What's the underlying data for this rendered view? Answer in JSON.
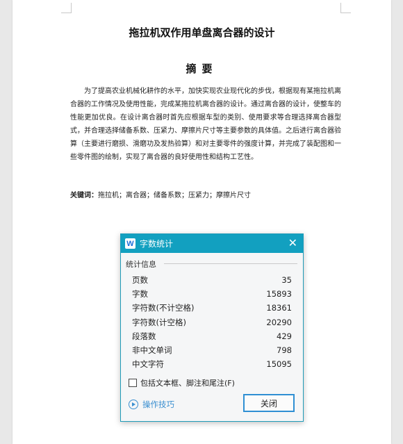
{
  "document": {
    "title": "拖拉机双作用单盘离合器的设计",
    "abstract_heading": "摘要",
    "abstract_body": "为了提高农业机械化耕作的水平，加快实现农业现代化的步伐，根据现有某拖拉机离合器的工作情况及使用性能，完成某拖拉机离合器的设计。通过离合器的设计，使整车的性能更加优良。在设计离合器时首先应根据车型的类别、使用要求等合理选择离合器型式，并合理选择储备系数、压紧力、摩擦片尺寸等主要参数的具体值。之后进行离合器验算（主要进行磨损、滑磨功及发热验算）和对主要零件的强度计算，并完成了装配图和一些零件图的绘制，实现了离合器的良好使用性和结构工艺性。",
    "keywords_label": "关键词：",
    "keywords": "拖拉机；离合器；储备系数；压紧力；摩擦片尺寸"
  },
  "dialog": {
    "app_icon_letter": "W",
    "title": "字数统计",
    "close_glyph": "✕",
    "group_label": "统计信息",
    "stats": [
      {
        "label": "页数",
        "value": "35"
      },
      {
        "label": "字数",
        "value": "15893"
      },
      {
        "label": "字符数(不计空格)",
        "value": "18361"
      },
      {
        "label": "字符数(计空格)",
        "value": "20290"
      },
      {
        "label": "段落数",
        "value": "429"
      },
      {
        "label": "非中文单词",
        "value": "798"
      },
      {
        "label": "中文字符",
        "value": "15095"
      }
    ],
    "checkbox_label": "包括文本框、脚注和尾注(F)",
    "checkbox_checked": false,
    "tips_label": "操作技巧",
    "close_button": "关闭",
    "accent_color": "#12a0c0"
  }
}
